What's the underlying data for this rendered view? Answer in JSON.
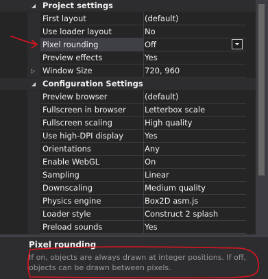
{
  "project_settings": {
    "header": "Project settings",
    "rows": [
      {
        "name": "First layout",
        "value": "(default)"
      },
      {
        "name": "Use loader layout",
        "value": "No"
      },
      {
        "name": "Pixel rounding",
        "value": "Off",
        "selected": true
      },
      {
        "name": "Preview effects",
        "value": "Yes"
      },
      {
        "name": "Window Size",
        "value": "720, 960",
        "expandable": true
      }
    ]
  },
  "configuration_settings": {
    "header": "Configuration Settings",
    "rows": [
      {
        "name": "Preview browser",
        "value": "(default)"
      },
      {
        "name": "Fullscreen in browser",
        "value": "Letterbox scale"
      },
      {
        "name": "Fullscreen scaling",
        "value": "High quality"
      },
      {
        "name": "Use high-DPI display",
        "value": "Yes"
      },
      {
        "name": "Orientations",
        "value": "Any"
      },
      {
        "name": "Enable WebGL",
        "value": "On"
      },
      {
        "name": "Sampling",
        "value": "Linear"
      },
      {
        "name": "Downscaling",
        "value": "Medium quality"
      },
      {
        "name": "Physics engine",
        "value": "Box2D asm.js"
      },
      {
        "name": "Loader style",
        "value": "Construct 2 splash"
      },
      {
        "name": "Preload sounds",
        "value": "Yes"
      }
    ]
  },
  "description": {
    "title": "Pixel rounding",
    "text": "If on, objects are always drawn at integer positions.  If off, objects can be drawn between pixels."
  },
  "icons": {
    "collapse": "collapse-triangle-icon",
    "expand": "expand-triangle-icon",
    "dropdown": "chevron-down-icon"
  },
  "colors": {
    "panel_bg": "#252526",
    "header_bg": "#2d2d30",
    "grid_line": "#3f3f46",
    "selected_bg": "#3f3f46",
    "text": "#f1f1f1",
    "description_text": "#999999",
    "annotation_red": "#e0141e"
  }
}
